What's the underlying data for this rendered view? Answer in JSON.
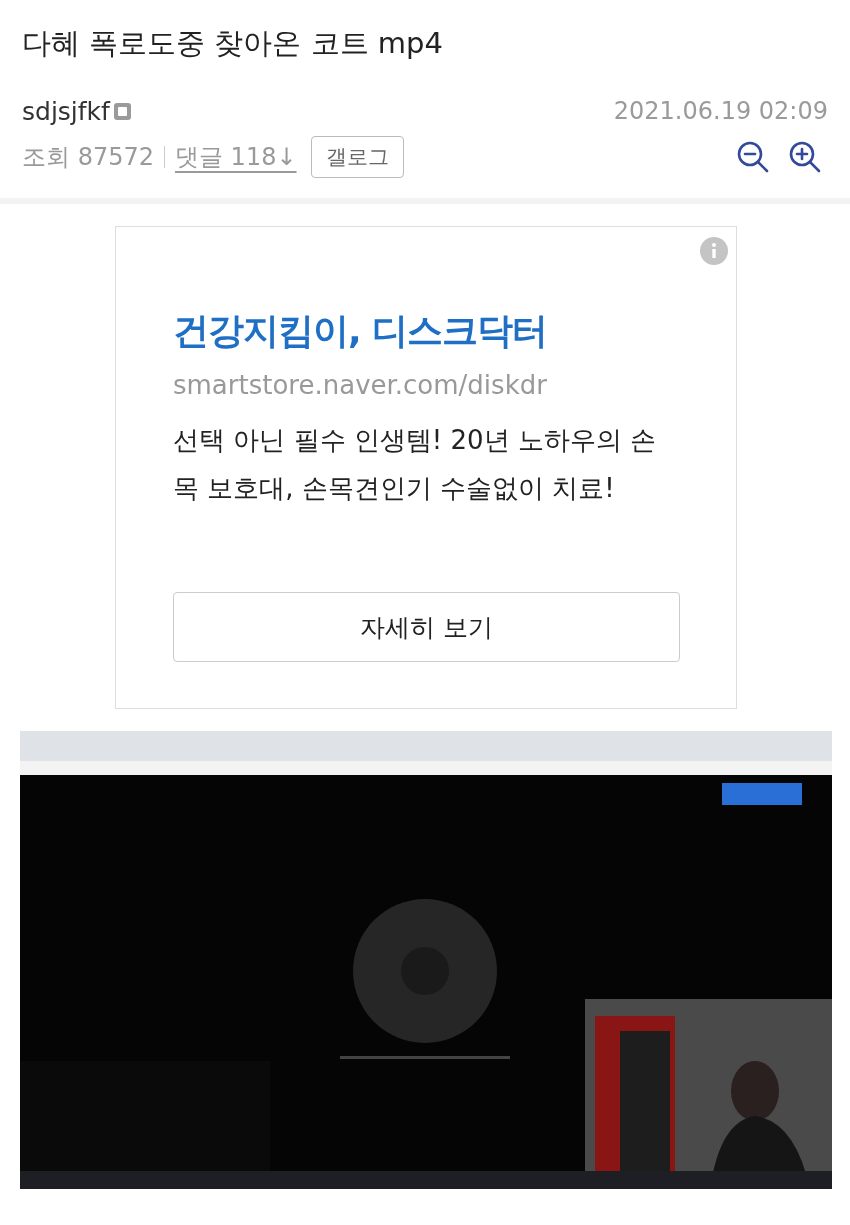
{
  "post": {
    "title": "다혜 폭로도중 찾아온 코트 mp4",
    "author": "sdjsjfkf",
    "date": "2021.06.19 02:09",
    "views_label": "조회",
    "views": "87572",
    "comments_label": "댓글",
    "comments": "118",
    "comments_arrow": "↓",
    "gallog_button": "갤로그"
  },
  "ad": {
    "headline": "건강지킴이, 디스크닥터",
    "url": "smartstore.naver.com/diskdr",
    "description": "선택 아닌 필수 인생템! 20년 노하우의 손목 보호대, 손목견인기 수술없이 치료!",
    "button": "자세히 보기"
  }
}
